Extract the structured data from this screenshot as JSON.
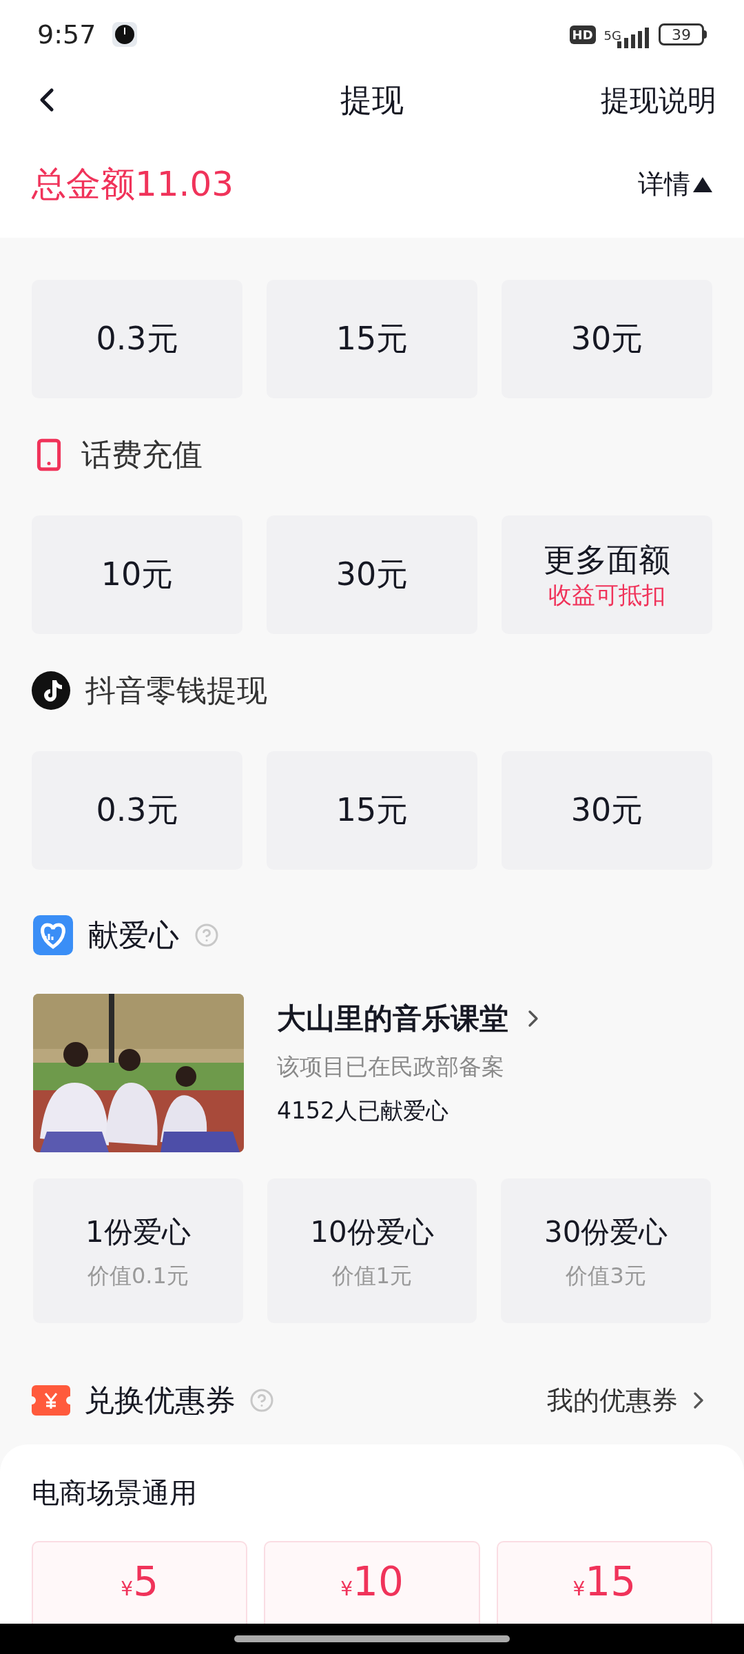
{
  "status_bar": {
    "time": "9:57",
    "hd": "HD",
    "network": "5G",
    "battery": "39"
  },
  "header": {
    "title": "提现",
    "action": "提现说明"
  },
  "total": {
    "label": "总金额11.03",
    "detail": "详情",
    "expanded": true
  },
  "sections": [
    {
      "options": [
        {
          "label": "0.3元"
        },
        {
          "label": "15元"
        },
        {
          "label": "30元"
        }
      ]
    },
    {
      "kind": "phone",
      "title": "话费充值",
      "options": [
        {
          "label": "10元"
        },
        {
          "label": "30元"
        },
        {
          "label": "更多面额",
          "note": "收益可抵扣"
        }
      ]
    },
    {
      "kind": "note",
      "title": "抖音零钱提现",
      "options": [
        {
          "label": "0.3元"
        },
        {
          "label": "15元"
        },
        {
          "label": "30元"
        }
      ]
    }
  ],
  "charity": {
    "title": "献爱心",
    "project": {
      "name": "大山里的音乐课堂",
      "note": "该项目已在民政部备案",
      "count": "4152人已献爱心"
    },
    "options": [
      {
        "label": "1份爱心",
        "value": "价值0.1元"
      },
      {
        "label": "10份爱心",
        "value": "价值1元"
      },
      {
        "label": "30份爱心",
        "value": "价值3元"
      }
    ]
  },
  "coupons": {
    "title": "兑换优惠券",
    "link": "我的优惠券",
    "group": "电商场景通用",
    "items": [
      {
        "symbol": "¥",
        "amount": "5"
      },
      {
        "symbol": "¥",
        "amount": "10"
      },
      {
        "symbol": "¥",
        "amount": "15"
      }
    ]
  }
}
